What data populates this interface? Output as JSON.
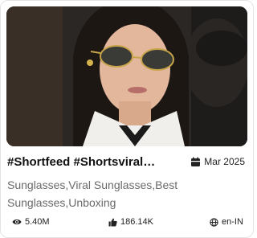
{
  "card": {
    "title": "#Shortfeed #Shortsviral…",
    "date": "Mar 2025",
    "tags": "Sunglasses,Viral Sunglasses,Best Sunglasses,Unboxing",
    "views": "5.40M",
    "likes": "186.14K",
    "language": "en-IN"
  },
  "icons": {
    "date": "calendar-icon",
    "views": "eye-icon",
    "likes": "thumbs-up-icon",
    "language": "globe-icon"
  },
  "colors": {
    "title": "#111111",
    "tags": "#6a6a6a",
    "border": "#e3e3e3"
  }
}
